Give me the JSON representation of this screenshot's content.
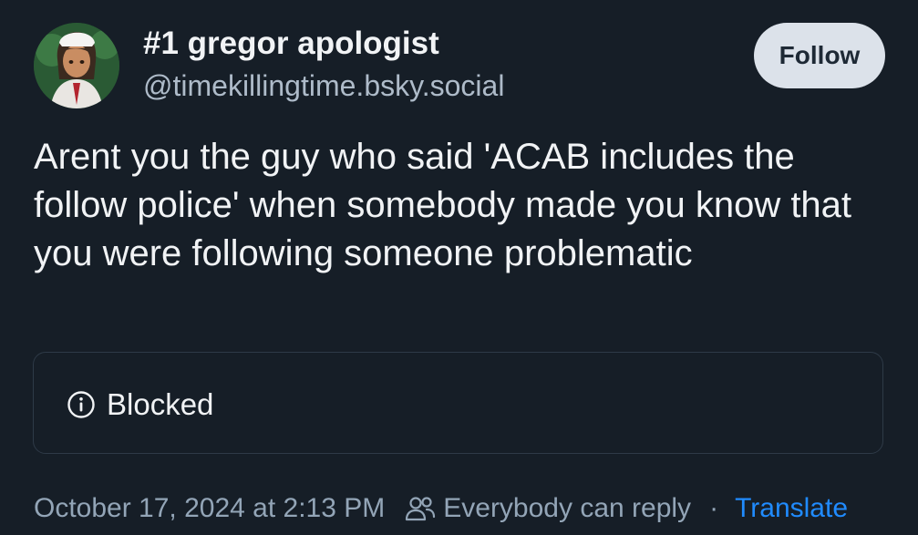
{
  "author": {
    "display_name": "#1 gregor apologist",
    "handle": "@timekillingtime.bsky.social",
    "avatar_icon": "anime-character-avatar"
  },
  "follow_button": {
    "label": "Follow"
  },
  "post": {
    "text": "Arent you the guy who said 'ACAB includes the follow police' when somebody made you know that you were following someone problematic"
  },
  "embed": {
    "icon": "info-icon",
    "label": "Blocked"
  },
  "meta": {
    "timestamp": "October 17, 2024 at 2:13 PM",
    "reply_icon": "people-icon",
    "reply_setting": "Everybody can reply",
    "separator": "·",
    "translate_label": "Translate"
  },
  "colors": {
    "background": "#161e27",
    "text": "#f1f3f5",
    "muted": "#93a5b7",
    "link": "#208bfe",
    "button_bg": "#dce2ea"
  }
}
